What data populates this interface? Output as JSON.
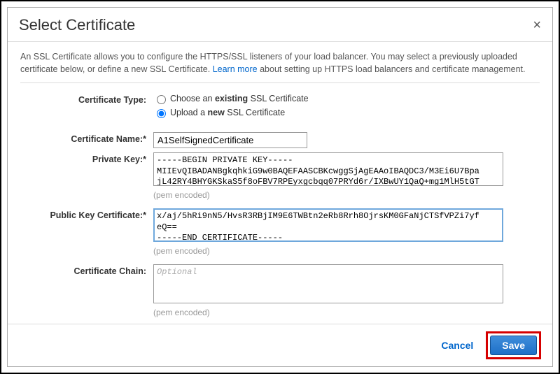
{
  "modal": {
    "title": "Select Certificate",
    "close_char": "×",
    "intro_pre": "An SSL Certificate allows you to configure the HTTPS/SSL listeners of your load balancer. You may select a previously uploaded certificate below, or define a new SSL Certificate. ",
    "learn_more": "Learn more",
    "intro_post": " about setting up HTTPS load balancers and certificate management."
  },
  "form": {
    "cert_type": {
      "label": "Certificate Type:",
      "opt_existing_pre": "Choose an ",
      "opt_existing_b": "existing",
      "opt_existing_post": " SSL Certificate",
      "opt_upload_pre": "Upload a ",
      "opt_upload_b": "new",
      "opt_upload_post": " SSL Certificate"
    },
    "cert_name": {
      "label": "Certificate Name:*",
      "value": "A1SelfSignedCertificate"
    },
    "private_key": {
      "label": "Private Key:*",
      "value": "-----BEGIN PRIVATE KEY-----\nMIIEvQIBADANBgkqhkiG9w0BAQEFAASCBKcwggSjAgEAAoIBAQDC3/M3Ei6U7Bpa\njL42RY4BHYGKSkaS5f8oFBV7RPEyxgcbqq07PRYd6r/IXBwUY1QaQ+mg1MlH5tGT",
      "hint": "(pem encoded)"
    },
    "public_cert": {
      "label": "Public Key Certificate:*",
      "value": "x/aj/5hRi9nN5/HvsR3RBjIM9E6TWBtn2eRb8Rrh8OjrsKM0GFaNjCTSfVPZi7yf\neQ==\n-----END CERTIFICATE-----",
      "hint": "(pem encoded)"
    },
    "cert_chain": {
      "label": "Certificate Chain:",
      "placeholder": "Optional",
      "value": "",
      "hint": "(pem encoded)"
    }
  },
  "footer": {
    "cancel": "Cancel",
    "save": "Save"
  }
}
